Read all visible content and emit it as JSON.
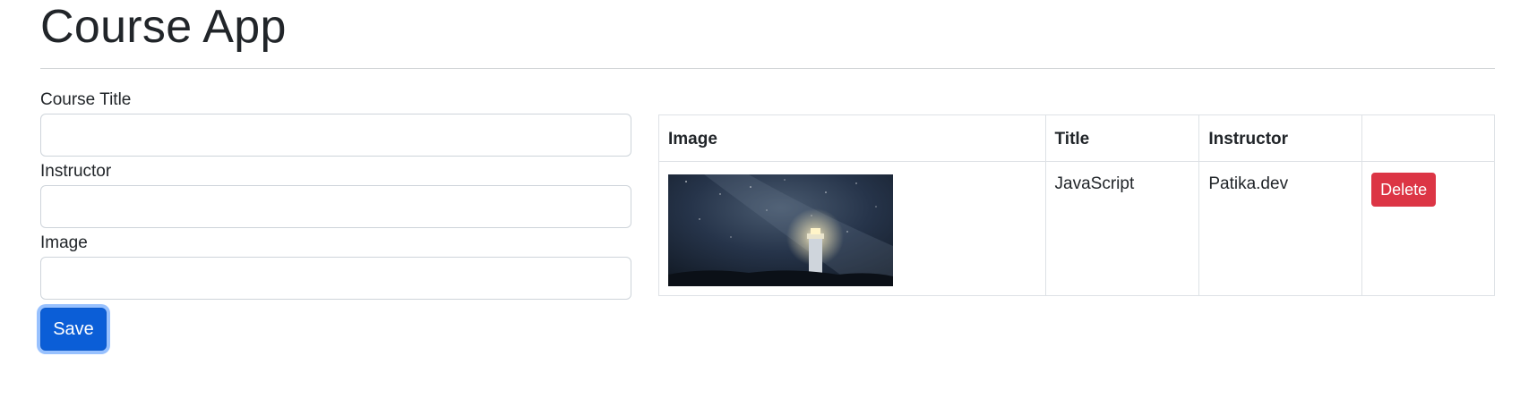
{
  "app": {
    "title": "Course App"
  },
  "form": {
    "course_title_label": "Course Title",
    "course_title_value": "",
    "instructor_label": "Instructor",
    "instructor_value": "",
    "image_label": "Image",
    "image_value": "",
    "save_label": "Save"
  },
  "table": {
    "headers": [
      "Image",
      "Title",
      "Instructor",
      ""
    ],
    "rows": [
      {
        "image_alt": "lighthouse under milky way night sky",
        "title": "JavaScript",
        "instructor": "Patika.dev",
        "delete_label": "Delete"
      }
    ]
  },
  "colors": {
    "primary": "#0b5ed7",
    "danger": "#dc3545",
    "text": "#212529",
    "border": "#dee2e6"
  }
}
